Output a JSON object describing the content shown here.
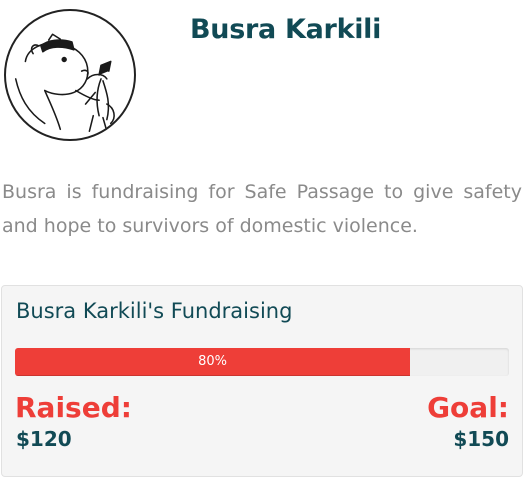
{
  "profile": {
    "name": "Busra Karkili",
    "avatar_icon": "polar-bear-drawing-icon",
    "description": "Busra is fundraising for Safe Passage to give safety and hope to survivors of domestic violence."
  },
  "fundraising": {
    "title": "Busra Karkili's Fundraising",
    "progress_label": "80%",
    "progress_fraction": 0.8,
    "raised_label": "Raised:",
    "raised_value": "$120",
    "goal_label": "Goal:",
    "goal_value": "$150"
  },
  "colors": {
    "accent_red": "#ee3e38",
    "heading_teal": "#114a55",
    "body_gray": "#8a8a8a",
    "card_bg": "#f5f5f5"
  }
}
